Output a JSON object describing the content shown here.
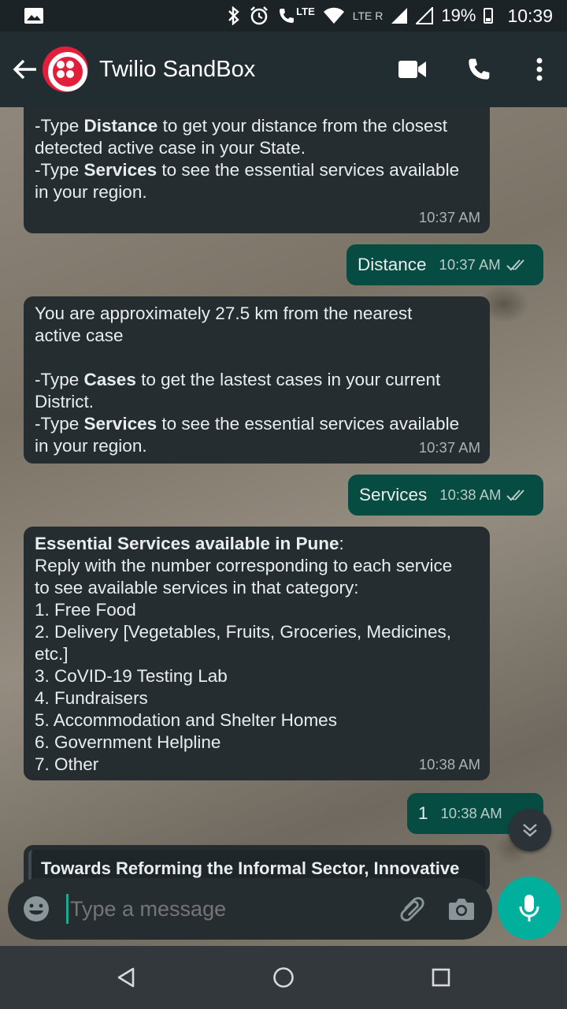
{
  "status_bar": {
    "lte_top": "LTE",
    "lte_r": "LTE R",
    "battery": "19%",
    "time": "10:39"
  },
  "header": {
    "title": "Twilio SandBox"
  },
  "messages": {
    "m1": {
      "lines": [
        {
          "pre": "-Type ",
          "bold": "Distance",
          "post": " to get your distance from the closest"
        },
        {
          "pre": "detected active case in your State.",
          "bold": "",
          "post": ""
        },
        {
          "pre": "-Type ",
          "bold": "Services",
          "post": " to see the essential services available"
        },
        {
          "pre": "in your region.",
          "bold": "",
          "post": ""
        }
      ],
      "time": "10:37 AM"
    },
    "o1": {
      "text": "Distance",
      "time": "10:37 AM"
    },
    "m2": {
      "lines": [
        {
          "pre": "You are approximately 27.5 km from the nearest",
          "bold": "",
          "post": ""
        },
        {
          "pre": "active case",
          "bold": "",
          "post": ""
        },
        {
          "pre": "",
          "bold": "",
          "post": ""
        },
        {
          "pre": "-Type ",
          "bold": "Cases",
          "post": " to get the lastest cases in your current"
        },
        {
          "pre": "District.",
          "bold": "",
          "post": ""
        },
        {
          "pre": "-Type ",
          "bold": "Services",
          "post": " to see the essential services available"
        },
        {
          "pre": "in your region.",
          "bold": "",
          "post": ""
        }
      ],
      "time": "10:37 AM"
    },
    "o2": {
      "text": "Services",
      "time": "10:38 AM"
    },
    "m3": {
      "lines": [
        {
          "pre": "",
          "bold": "Essential Services available in Pune",
          "post": ":"
        },
        {
          "pre": "Reply with the number corresponding to each service",
          "bold": "",
          "post": ""
        },
        {
          "pre": "to see available services in that category:",
          "bold": "",
          "post": ""
        },
        {
          "pre": "1. Free Food",
          "bold": "",
          "post": ""
        },
        {
          "pre": "2. Delivery [Vegetables, Fruits, Groceries, Medicines,",
          "bold": "",
          "post": ""
        },
        {
          "pre": "etc.]",
          "bold": "",
          "post": ""
        },
        {
          "pre": "3. CoVID-19 Testing Lab",
          "bold": "",
          "post": ""
        },
        {
          "pre": "4. Fundraisers",
          "bold": "",
          "post": ""
        },
        {
          "pre": "5. Accommodation and Shelter Homes",
          "bold": "",
          "post": ""
        },
        {
          "pre": "6. Government Helpline",
          "bold": "",
          "post": ""
        },
        {
          "pre": "7. Other",
          "bold": "",
          "post": ""
        }
      ],
      "time": "10:38 AM"
    },
    "o3": {
      "text": "1",
      "time": "10:38 AM"
    },
    "m4": {
      "lines": [
        {
          "pre": "",
          "bold": "Towards Reforming the Informal Sector, Innovative",
          "post": ""
        }
      ]
    }
  },
  "composer": {
    "placeholder": "Type a message"
  },
  "colors": {
    "incoming_bubble": "#262d31",
    "outgoing_bubble": "#074c42",
    "accent": "#00af9c",
    "header": "#222d32"
  }
}
